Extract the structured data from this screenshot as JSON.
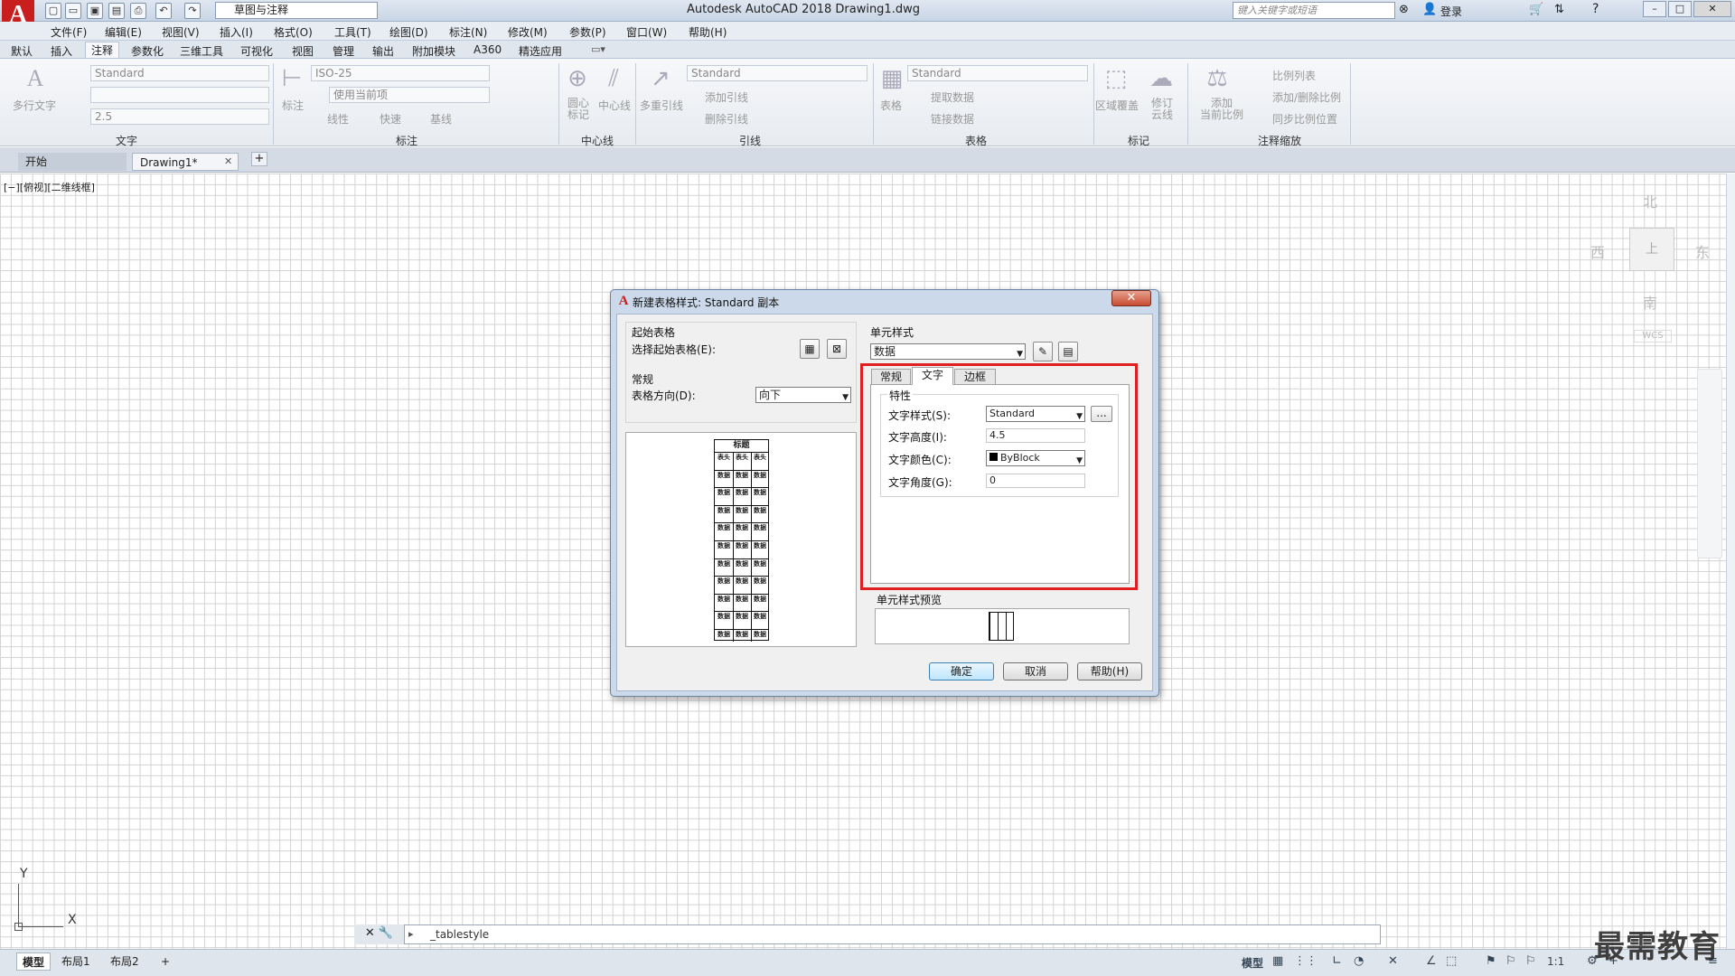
{
  "titlebar": {
    "logo": "A",
    "workspace": "草图与注释",
    "app_title": "Autodesk AutoCAD 2018    Drawing1.dwg",
    "search_placeholder": "键入关键字或短语",
    "login": "登录"
  },
  "menu": [
    "文件(F)",
    "编辑(E)",
    "视图(V)",
    "插入(I)",
    "格式(O)",
    "工具(T)",
    "绘图(D)",
    "标注(N)",
    "修改(M)",
    "参数(P)",
    "窗口(W)",
    "帮助(H)"
  ],
  "ribbon_tabs": [
    "默认",
    "插入",
    "注释",
    "参数化",
    "三维工具",
    "可视化",
    "视图",
    "管理",
    "输出",
    "附加模块",
    "A360",
    "精选应用"
  ],
  "ribbon_active_tab": "注释",
  "ribbon": {
    "text_panel": {
      "label": "文字",
      "multiline": "多行文字",
      "style": "Standard",
      "height": "2.5"
    },
    "dim_panel": {
      "label": "标注",
      "style": "ISO-25",
      "use_current": "使用当前项",
      "dim_button": "标注",
      "linear": "线性",
      "quick": "快速",
      "baseline": "基线"
    },
    "center_panel": {
      "label": "中心线",
      "center_mark": "圆心\n标记",
      "centerline": "中心线"
    },
    "leader_panel": {
      "label": "引线",
      "style": "Standard",
      "multileader": "多重引线",
      "add": "添加引线",
      "remove": "删除引线"
    },
    "table_panel": {
      "label": "表格",
      "style": "Standard",
      "table": "表格",
      "extract": "提取数据",
      "link": "链接数据"
    },
    "markup_panel": {
      "label": "标记",
      "wipeout": "区域覆盖",
      "revcloud": "修订\n云线"
    },
    "scale_panel": {
      "label": "注释缩放",
      "add_current": "添加\n当前比例",
      "scale_list": "比例列表",
      "add_delete": "添加/删除比例",
      "sync": "同步比例位置"
    }
  },
  "doc_tabs": [
    "开始",
    "Drawing1*"
  ],
  "viewport_label": "[−][俯视][二维线框]",
  "compass": {
    "north": "北",
    "south": "南",
    "east": "东",
    "west": "西",
    "top": "上",
    "wcs": "WCS"
  },
  "ucs": {
    "x": "X",
    "y": "Y"
  },
  "command_line": "_tablestyle",
  "layout_tabs": [
    "模型",
    "布局1",
    "布局2"
  ],
  "status": {
    "model": "模型",
    "scale": "1:1"
  },
  "watermark": "最需教育",
  "dialog": {
    "title": "新建表格样式: Standard 副本",
    "start_table_group": "起始表格",
    "select_start_table": "选择起始表格(E):",
    "general_group": "常规",
    "direction_label": "表格方向(D):",
    "direction_value": "向下",
    "cell_style_group": "单元样式",
    "cell_style_value": "数据",
    "tabs": [
      "常规",
      "文字",
      "边框"
    ],
    "active_tab": "文字",
    "properties_group": "特性",
    "text_style_label": "文字样式(S):",
    "text_style_value": "Standard",
    "text_height_label": "文字高度(I):",
    "text_height_value": "4.5",
    "text_color_label": "文字颜色(C):",
    "text_color_value": "ByBlock",
    "text_angle_label": "文字角度(G):",
    "text_angle_value": "0",
    "cell_preview_group": "单元样式预览",
    "ok": "确定",
    "cancel": "取消",
    "help": "帮助(H)",
    "browse": "...",
    "preview_title": "标题",
    "preview_header": "表头",
    "preview_data": "数据"
  },
  "colors": {
    "highlight": "#e02020",
    "brand": "#c81e1e"
  }
}
